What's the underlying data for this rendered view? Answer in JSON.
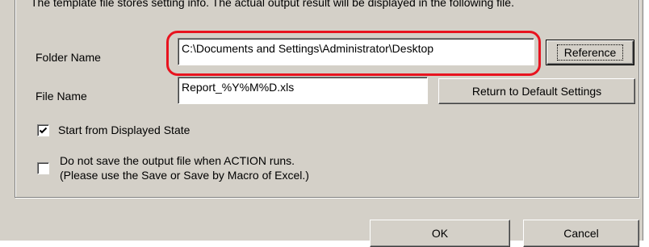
{
  "info": {
    "text": "The template file stores setting info. The actual output result will be displayed in the following file."
  },
  "folder": {
    "label": "Folder Name",
    "value": "C:\\Documents and Settings\\Administrator\\Desktop",
    "reference_button": "Reference"
  },
  "file": {
    "label": "File Name",
    "value": "Report_%Y%M%D.xls",
    "default_button": "Return to Default Settings"
  },
  "options": {
    "start_from_displayed": {
      "label": "Start from Displayed State",
      "checked": true
    },
    "do_not_save": {
      "line1": "Do not save the output file when ACTION runs.",
      "line2": "(Please use the Save or Save by Macro of Excel.)",
      "checked": false
    }
  },
  "footer": {
    "ok_label": "OK",
    "cancel_label": "Cancel"
  },
  "colors": {
    "dialog_bg": "#d4d0c8",
    "highlight": "#e8131f"
  }
}
